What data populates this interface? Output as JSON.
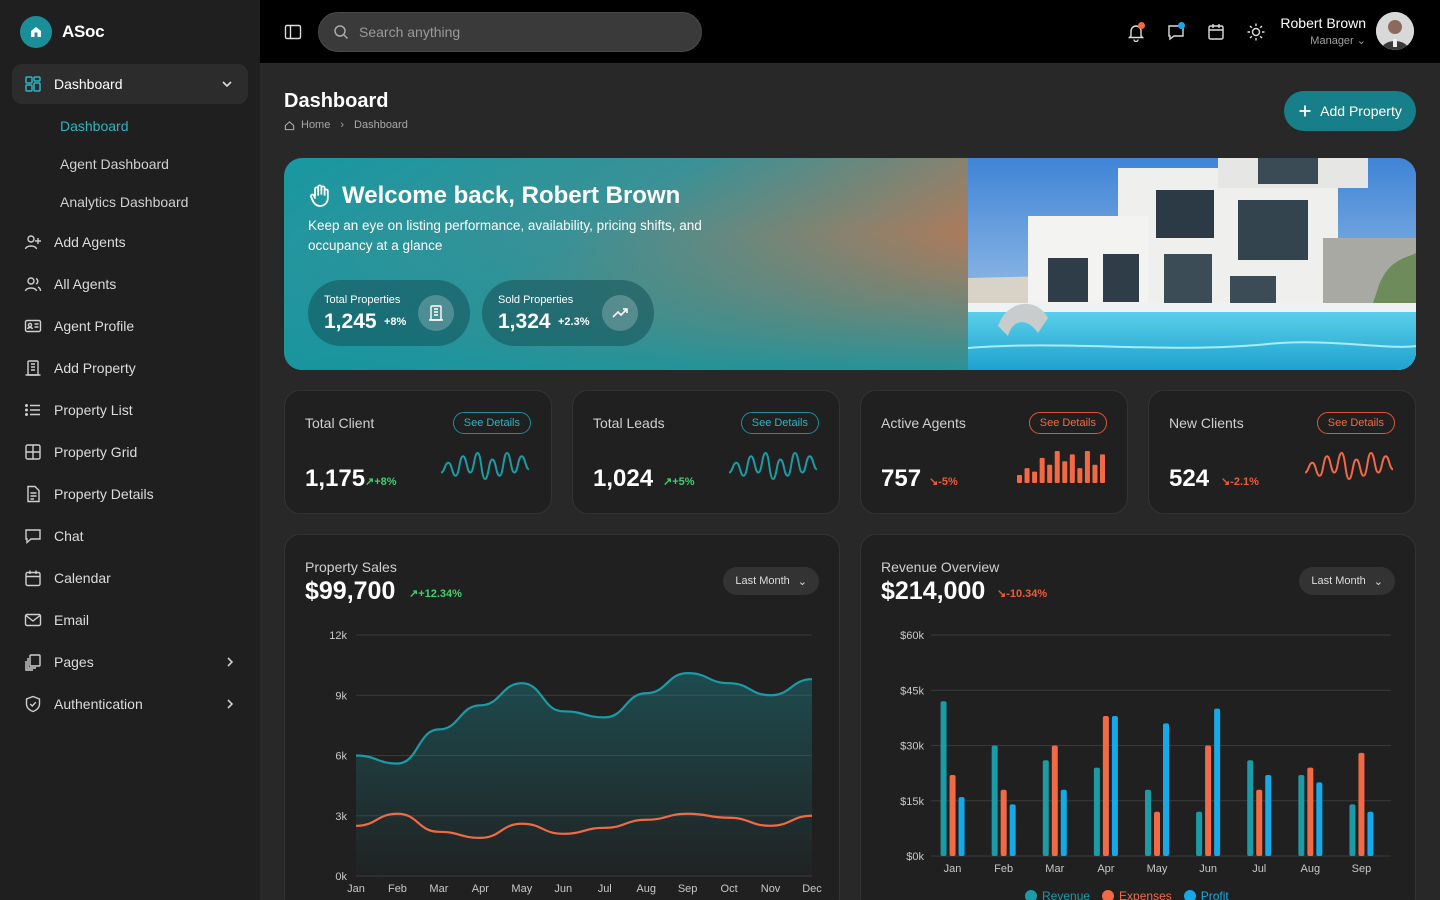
{
  "brand": {
    "name": "ASoc"
  },
  "sidebar": {
    "dashboard_label": "Dashboard",
    "sub_items": [
      {
        "label": "Dashboard",
        "active": true
      },
      {
        "label": "Agent Dashboard"
      },
      {
        "label": "Analytics Dashboard"
      }
    ],
    "items": [
      {
        "label": "Add Agents",
        "icon": "user-plus-icon"
      },
      {
        "label": "All Agents",
        "icon": "users-icon"
      },
      {
        "label": "Agent Profile",
        "icon": "id-card-icon"
      },
      {
        "label": "Add Property",
        "icon": "building-icon"
      },
      {
        "label": "Property List",
        "icon": "list-icon"
      },
      {
        "label": "Property Grid",
        "icon": "grid-icon"
      },
      {
        "label": "Property Details",
        "icon": "document-icon"
      },
      {
        "label": "Chat",
        "icon": "chat-icon"
      },
      {
        "label": "Calendar",
        "icon": "calendar-icon"
      },
      {
        "label": "Email",
        "icon": "mail-icon"
      },
      {
        "label": "Pages",
        "icon": "pages-icon"
      },
      {
        "label": "Authentication",
        "icon": "shield-icon"
      }
    ]
  },
  "topbar": {
    "search_placeholder": "Search anything",
    "user_name": "Robert Brown",
    "user_role": "Manager"
  },
  "header": {
    "title": "Dashboard",
    "breadcrumb_home": "Home",
    "breadcrumb_current": "Dashboard",
    "add_button": "Add Property"
  },
  "hero": {
    "title": "Welcome back, Robert Brown",
    "subtitle": "Keep an eye on listing performance, availability, pricing shifts, and occupancy at a glance",
    "stats": [
      {
        "label": "Total Properties",
        "value": "1,245",
        "change": "+8%"
      },
      {
        "label": "Sold Properties",
        "value": "1,324",
        "change": "+2.3%"
      }
    ]
  },
  "cards": [
    {
      "title": "Total Client",
      "value": "1,175",
      "change": "+8%",
      "trend": "up",
      "button": "See Details",
      "color": "#1a9ba6"
    },
    {
      "title": "Total Leads",
      "value": "1,024",
      "change": "+5%",
      "trend": "up",
      "button": "See Details",
      "color": "#1a9ba6"
    },
    {
      "title": "Active Agents",
      "value": "757",
      "change": "-5%",
      "trend": "down",
      "button": "See Details",
      "color": "#f26a45"
    },
    {
      "title": "New Clients",
      "value": "524",
      "change": "-2.1%",
      "trend": "down",
      "button": "See Details",
      "color": "#f26a45"
    }
  ],
  "sales": {
    "title": "Property Sales",
    "value": "$99,700",
    "change": "+12.34%",
    "range": "Last Month"
  },
  "revenue": {
    "title": "Revenue Overview",
    "value": "$214,000",
    "change": "-10.34%",
    "range": "Last Month"
  },
  "chart_data": [
    {
      "type": "area",
      "title": "Property Sales",
      "categories": [
        "Jan",
        "Feb",
        "Mar",
        "Apr",
        "May",
        "Jun",
        "Jul",
        "Aug",
        "Sep",
        "Oct",
        "Nov",
        "Dec"
      ],
      "ylim": [
        0,
        12000
      ],
      "yticks": [
        "0k",
        "3k",
        "6k",
        "9k",
        "12k"
      ],
      "grid": true,
      "series": [
        {
          "values": [
            6000,
            5600,
            7300,
            8500,
            9600,
            8200,
            7900,
            9100,
            10100,
            9600,
            9000,
            9800
          ],
          "color": "#1a9ba6"
        },
        {
          "values": [
            2500,
            3100,
            2200,
            1900,
            2600,
            2100,
            2400,
            2800,
            3100,
            2900,
            2500,
            3000
          ],
          "color": "#f26a45"
        }
      ]
    },
    {
      "type": "bar",
      "title": "Revenue Overview",
      "categories": [
        "Jan",
        "Feb",
        "Mar",
        "Apr",
        "May",
        "Jun",
        "Jul",
        "Aug",
        "Sep"
      ],
      "ylim": [
        0,
        60000
      ],
      "yticks": [
        "$0k",
        "$15k",
        "$30k",
        "$45k",
        "$60k"
      ],
      "grid": true,
      "legend": "bottom",
      "series": [
        {
          "name": "Revenue",
          "values": [
            42000,
            30000,
            26000,
            24000,
            18000,
            12000,
            26000,
            22000,
            14000
          ],
          "color": "#1a9ba6"
        },
        {
          "name": "Expenses",
          "values": [
            22000,
            18000,
            30000,
            38000,
            12000,
            30000,
            18000,
            24000,
            28000
          ],
          "color": "#f26a45"
        },
        {
          "name": "Profit",
          "values": [
            16000,
            14000,
            18000,
            38000,
            36000,
            40000,
            22000,
            20000,
            12000
          ],
          "color": "#16a9e8"
        }
      ]
    }
  ],
  "sparklines": [
    [
      6,
      9,
      5,
      11,
      6,
      12,
      4,
      10,
      5,
      12,
      6,
      11,
      7
    ],
    [
      6,
      9,
      5,
      11,
      6,
      12,
      4,
      10,
      5,
      12,
      6,
      11,
      7
    ],
    [
      4,
      6,
      5,
      9,
      7,
      11,
      8,
      10,
      6,
      11,
      7,
      10
    ],
    [
      6,
      9,
      5,
      11,
      6,
      12,
      4,
      10,
      5,
      12,
      6,
      11,
      7
    ]
  ]
}
